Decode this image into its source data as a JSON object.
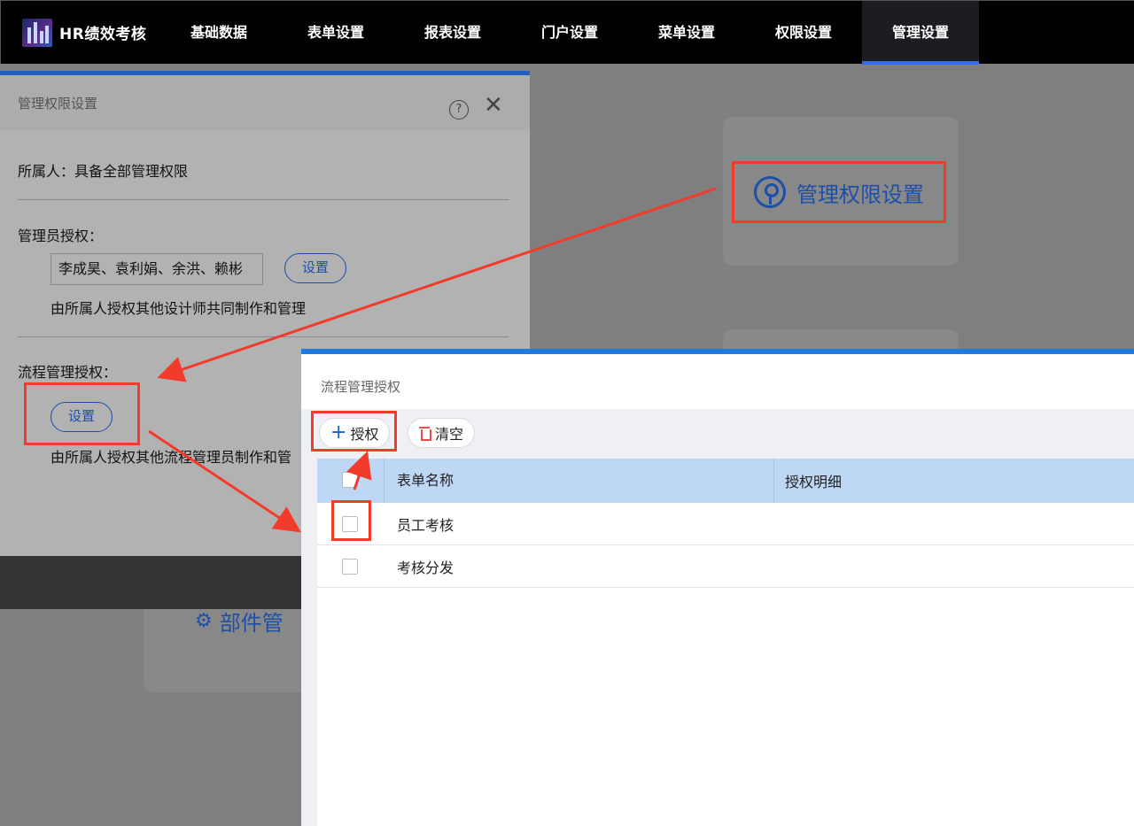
{
  "nav": {
    "brand": "HR绩效考核",
    "items": [
      "基础数据",
      "表单设置",
      "报表设置",
      "门户设置",
      "菜单设置",
      "权限设置",
      "管理设置"
    ],
    "active_index": 6
  },
  "background": {
    "key_card_label": "管理权限设置",
    "component_card_label": "部件管"
  },
  "dialog1": {
    "title": "管理权限设置",
    "owner_text": "所属人：具备全部管理权限",
    "admin_label": "管理员授权：",
    "admin_value": "李成昊、袁利娟、余洪、赖彬",
    "admin_button": "设置",
    "admin_note": "由所属人授权其他设计师共同制作和管理",
    "flow_label": "流程管理授权：",
    "flow_button": "设置",
    "flow_note": "由所属人授权其他流程管理员制作和管"
  },
  "dialog2": {
    "title": "流程管理授权",
    "toolbar": {
      "grant_label": "授权",
      "clear_label": "清空"
    },
    "table": {
      "columns": [
        "表单名称",
        "授权明细"
      ],
      "rows": [
        {
          "name": "员工考核",
          "detail": ""
        },
        {
          "name": "考核分发",
          "detail": ""
        }
      ]
    }
  },
  "colors": {
    "accent": "#1f5fbf",
    "annotation": "#f23b2b",
    "nav_bg": "#000000",
    "table_header": "#bdd7f5"
  }
}
